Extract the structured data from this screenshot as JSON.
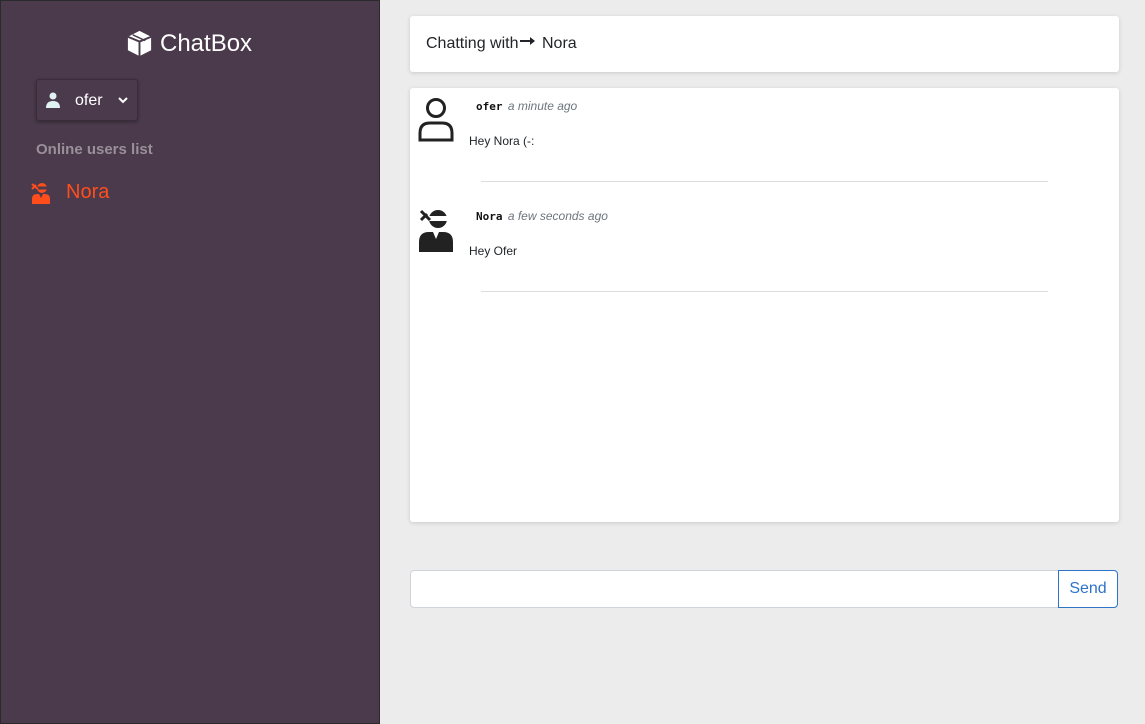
{
  "app": {
    "title": "ChatBox"
  },
  "sidebar": {
    "current_user": {
      "name": "ofer",
      "icon": "user-icon"
    },
    "online_title": "Online users list",
    "online_users": [
      {
        "name": "Nora",
        "icon": "ninja-icon",
        "color": "#ff4d1c"
      }
    ]
  },
  "header": {
    "chatting_label": "Chatting with",
    "partner": "Nora"
  },
  "messages": [
    {
      "author": "ofer",
      "time": "a minute ago",
      "text": "Hey Nora (-:",
      "avatar": "user-outline-icon"
    },
    {
      "author": "Nora",
      "time": "a few seconds ago",
      "text": "Hey Ofer",
      "avatar": "ninja-icon"
    }
  ],
  "composer": {
    "placeholder": "",
    "send_label": "Send"
  },
  "colors": {
    "sidebar_bg": "#4a3a4b",
    "accent": "#ff4d1c",
    "send": "#2f73c9"
  }
}
